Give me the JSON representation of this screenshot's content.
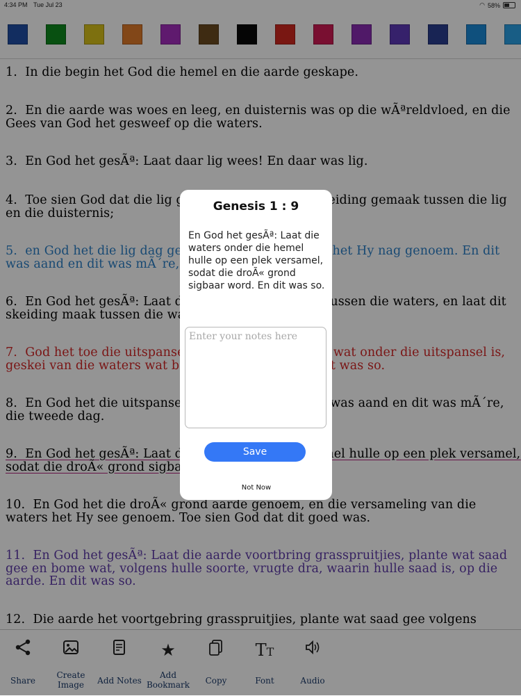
{
  "status_bar": {
    "time": "4:34 PM",
    "date": "Tue Jul 23",
    "battery": "58%"
  },
  "swatches": [
    {
      "name": "blue",
      "color": "#1f4fa6"
    },
    {
      "name": "green",
      "color": "#0e8a1e"
    },
    {
      "name": "yellow",
      "color": "#d8c21a"
    },
    {
      "name": "orange",
      "color": "#e07a2a"
    },
    {
      "name": "magenta",
      "color": "#a42ebd"
    },
    {
      "name": "brown",
      "color": "#6b4a1f"
    },
    {
      "name": "black",
      "color": "#0a0a0a"
    },
    {
      "name": "red",
      "color": "#d0281f"
    },
    {
      "name": "crimson",
      "color": "#d01a55"
    },
    {
      "name": "purple",
      "color": "#8a2bb4"
    },
    {
      "name": "violet",
      "color": "#5d3ab8"
    },
    {
      "name": "navy",
      "color": "#2a3e92"
    },
    {
      "name": "sky",
      "color": "#1b8ad8"
    },
    {
      "name": "light-blue",
      "color": "#2aa0e6"
    }
  ],
  "verses": [
    {
      "text": "1.  In die begin het God die hemel en die aarde geskape.",
      "style": ""
    },
    {
      "text": "2.  En die aarde was woes en leeg, en duisternis was op die wÃªreldvloed, en die Gees van God het gesweef op die waters.",
      "style": ""
    },
    {
      "text": "3.  En God het gesÃª: Laat daar lig wees! En daar was lig.",
      "style": ""
    },
    {
      "text": "4.  Toe sien God dat die lig goed was, en God het skeiding gemaak tussen die lig en die duisternis;",
      "style": ""
    },
    {
      "text": "5.  en God het die lig dag genoem, en die duisternis het Hy nag genoem. En dit was aand en dit was mÃ´re, die eerste dag.",
      "style": "highlight-blue"
    },
    {
      "text": "6.  En God het gesÃª: Laat daar 'n uitspansel wees tussen die waters, en laat dit skeiding maak tussen die waters.",
      "style": ""
    },
    {
      "text": "7.  God het toe die uitspansel gemaak en die waters wat onder die uitspansel is, geskei van die waters wat bo die uitspansel is; en dit was so.",
      "style": "highlight-red"
    },
    {
      "text": "8.  En God het die uitspansel hemel genoem. En dit was aand en dit was mÃ´re, die tweede dag.",
      "style": ""
    },
    {
      "text": "9.  En God het gesÃª: Laat die waters onder die hemel hulle op een plek versamel, sodat die droÃ« grond sigbaar word. En dit was so.",
      "style": "underlined"
    },
    {
      "text": "10.  En God het die droÃ« grond aarde genoem, en die versameling van die waters het Hy see genoem. Toe sien God dat dit goed was.",
      "style": ""
    },
    {
      "text": "11.  En God het gesÃª: Laat die aarde voortbring grasspruitjies, plante wat saad gee en bome wat, volgens hulle soorte, vrugte dra, waarin hulle saad is, op die aarde. En dit was so.",
      "style": "highlight-purple"
    },
    {
      "text": "12.  Die aarde het voortgebring grasspruitjies, plante wat saad gee volgens",
      "style": ""
    }
  ],
  "toolbar": {
    "share": "Share",
    "create_image": "Create Image",
    "add_notes": "Add Notes",
    "add_bookmark": "Add Bookmark",
    "copy": "Copy",
    "font": "Font",
    "audio": "Audio"
  },
  "dialog": {
    "title": "Genesis 1 : 9",
    "verse": " En God het gesÃª: Laat die waters onder die hemel hulle op een plek versamel, sodat die droÃ« grond sigbaar word. En dit was so.",
    "notes_placeholder": "Enter your notes here",
    "notes_value": "",
    "save_label": "Save",
    "not_now_label": "Not Now"
  }
}
